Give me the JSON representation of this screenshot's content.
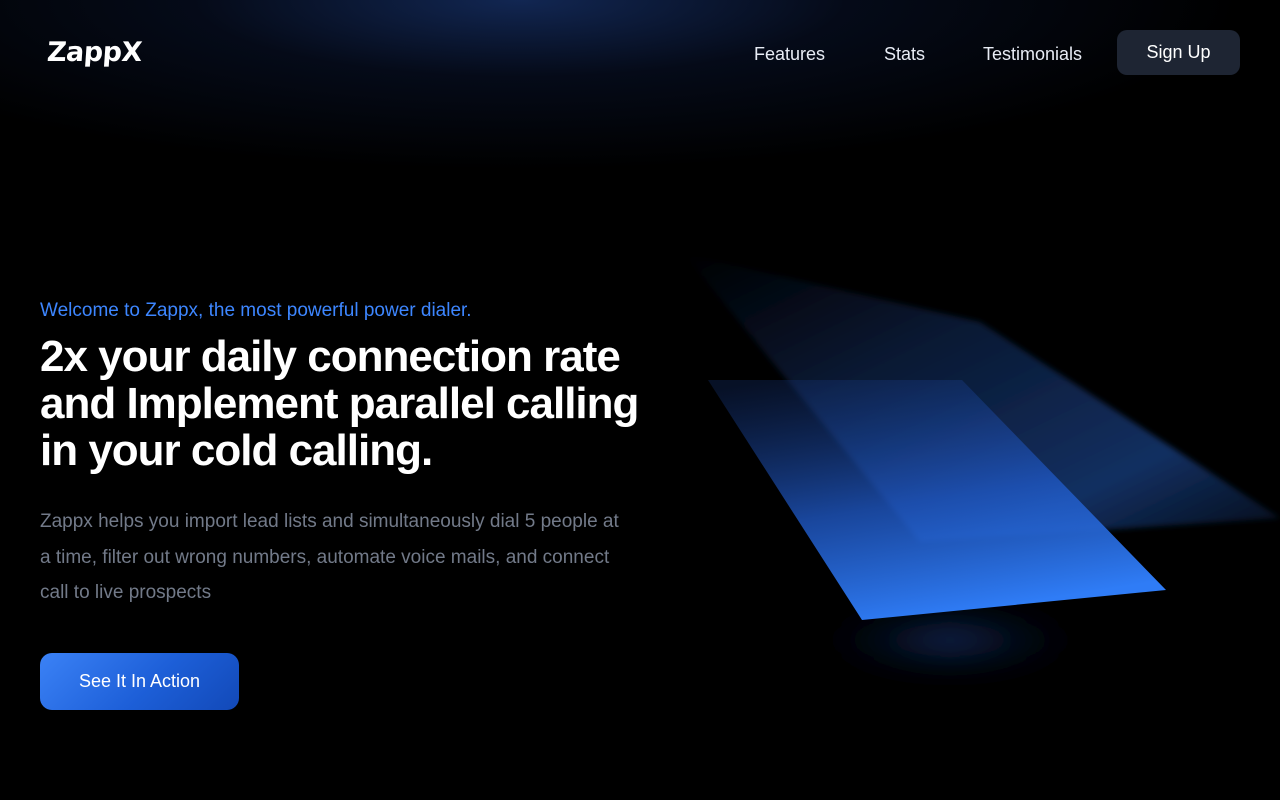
{
  "header": {
    "logo": "ZappX",
    "nav": {
      "features": "Features",
      "stats": "Stats",
      "testimonials": "Testimonials"
    },
    "signup_label": "Sign Up"
  },
  "hero": {
    "eyebrow": "Welcome to Zappx, the most powerful power dialer.",
    "headline": "2x your daily connection rate and Implement parallel calling in your cold calling.",
    "description": "Zappx helps you import lead lists and simultaneously dial 5 people at a time, filter out wrong numbers, automate voice mails, and connect call to live prospects",
    "cta_label": "See It In Action"
  },
  "colors": {
    "accent": "#3d86ff",
    "cta_start": "#3b82f6",
    "cta_end": "#1249b8",
    "signup_bg": "#1e2533",
    "body_text": "#727a89"
  }
}
